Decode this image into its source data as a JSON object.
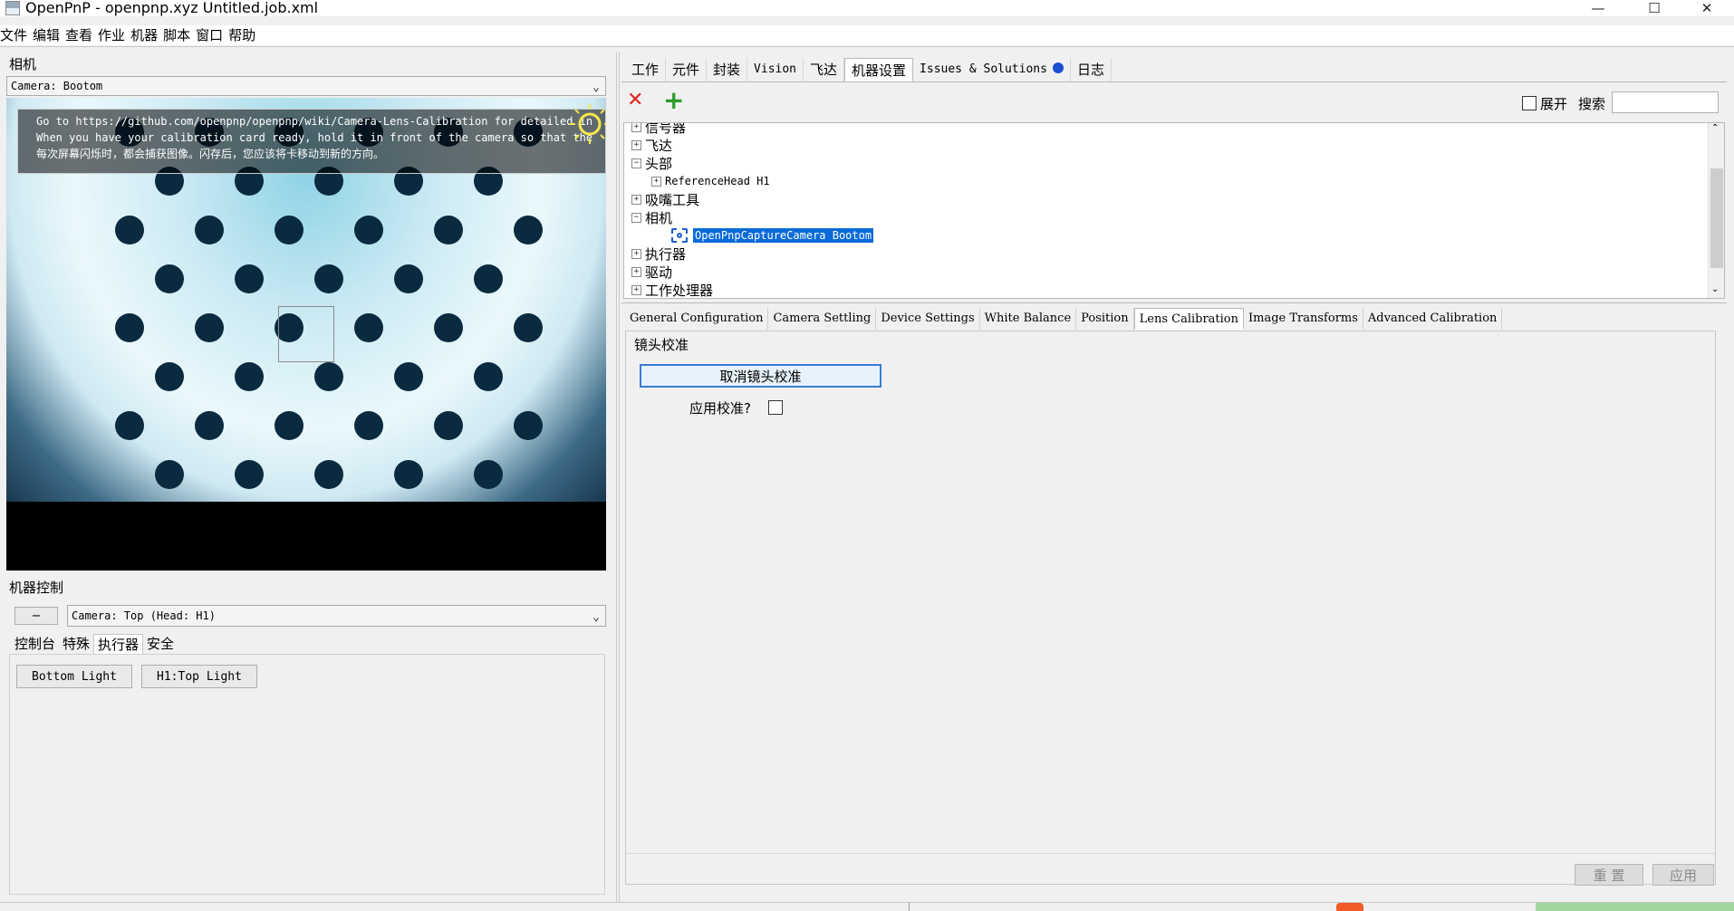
{
  "window": {
    "title": "OpenPnP - openpnp.xyz Untitled.job.xml",
    "minimize_glyph": "—",
    "maximize_glyph": "☐",
    "close_glyph": "✕"
  },
  "menu": [
    "文件",
    "编辑",
    "查看",
    "作业",
    "机器",
    "脚本",
    "窗口",
    "帮助"
  ],
  "camera_panel": {
    "label": "相机",
    "selected_camera": "Camera: Bootom",
    "overlay_lines": [
      "Go to https://github.com/openpnp/openpnp/wiki/Camera-Lens-Calibration for detailed in",
      "When you have your calibration card ready, hold it in front of the camera so that the",
      "每次屏幕闪烁时，都会捕获图像。闪存后，您应该将卡移动到新的方向。"
    ]
  },
  "machine_controls": {
    "label": "机器控制",
    "collapse_glyph": "−",
    "selected_camera": "Camera: Top (Head: H1)",
    "tabs": [
      "控制台",
      "特殊",
      "执行器",
      "安全"
    ],
    "selected_tab": "执行器",
    "actuator_buttons": [
      "Bottom Light",
      "H1:Top Light"
    ]
  },
  "right_tabs": [
    {
      "label": "工作",
      "font": "cjk"
    },
    {
      "label": "元件",
      "font": "cjk"
    },
    {
      "label": "封装",
      "font": "cjk"
    },
    {
      "label": "Vision",
      "font": "mono"
    },
    {
      "label": "飞达",
      "font": "cjk"
    },
    {
      "label": "机器设置",
      "font": "cjk"
    },
    {
      "label": "Issues & Solutions",
      "font": "mono"
    },
    {
      "label": "日志",
      "font": "cjk"
    }
  ],
  "right_selected_tab": "机器设置",
  "issues_indicator_color": "#1a4fd1",
  "toolbar": {
    "delete_glyph": "✕",
    "add_glyph": "+",
    "delete_color": "#e02020",
    "add_color": "#2a9d2a",
    "expand_label": "展开",
    "search_label": "搜索",
    "search_value": ""
  },
  "tree": {
    "items": [
      {
        "label": "信号器",
        "indent": 0,
        "expander": "+",
        "partial": true
      },
      {
        "label": "飞达",
        "indent": 0,
        "expander": "+"
      },
      {
        "label": "头部",
        "indent": 0,
        "expander": "−"
      },
      {
        "label": "ReferenceHead H1",
        "indent": 1,
        "expander": "+",
        "mono": true
      },
      {
        "label": "吸嘴工具",
        "indent": 0,
        "expander": "+"
      },
      {
        "label": "相机",
        "indent": 0,
        "expander": "−"
      },
      {
        "label": "OpenPnpCaptureCamera Bootom",
        "indent": 2,
        "expander": "",
        "mono": true,
        "selected": true
      },
      {
        "label": "执行器",
        "indent": 0,
        "expander": "+"
      },
      {
        "label": "驱动",
        "indent": 0,
        "expander": "+"
      },
      {
        "label": "工作处理器",
        "indent": 0,
        "expander": "+"
      }
    ],
    "selection_color": "#0a6bd8"
  },
  "settings_tabs": [
    "General Configuration",
    "Camera Settling",
    "Device Settings",
    "White Balance",
    "Position",
    "Lens Calibration",
    "Image Transforms",
    "Advanced Calibration"
  ],
  "settings_selected_tab": "Lens Calibration",
  "lens_calibration": {
    "group_label": "镜头校准",
    "cancel_button": "取消镜头校准",
    "apply_label": "应用校准?",
    "apply_checked": false
  },
  "footer_buttons": {
    "reset": "重 置",
    "apply": "应用"
  }
}
